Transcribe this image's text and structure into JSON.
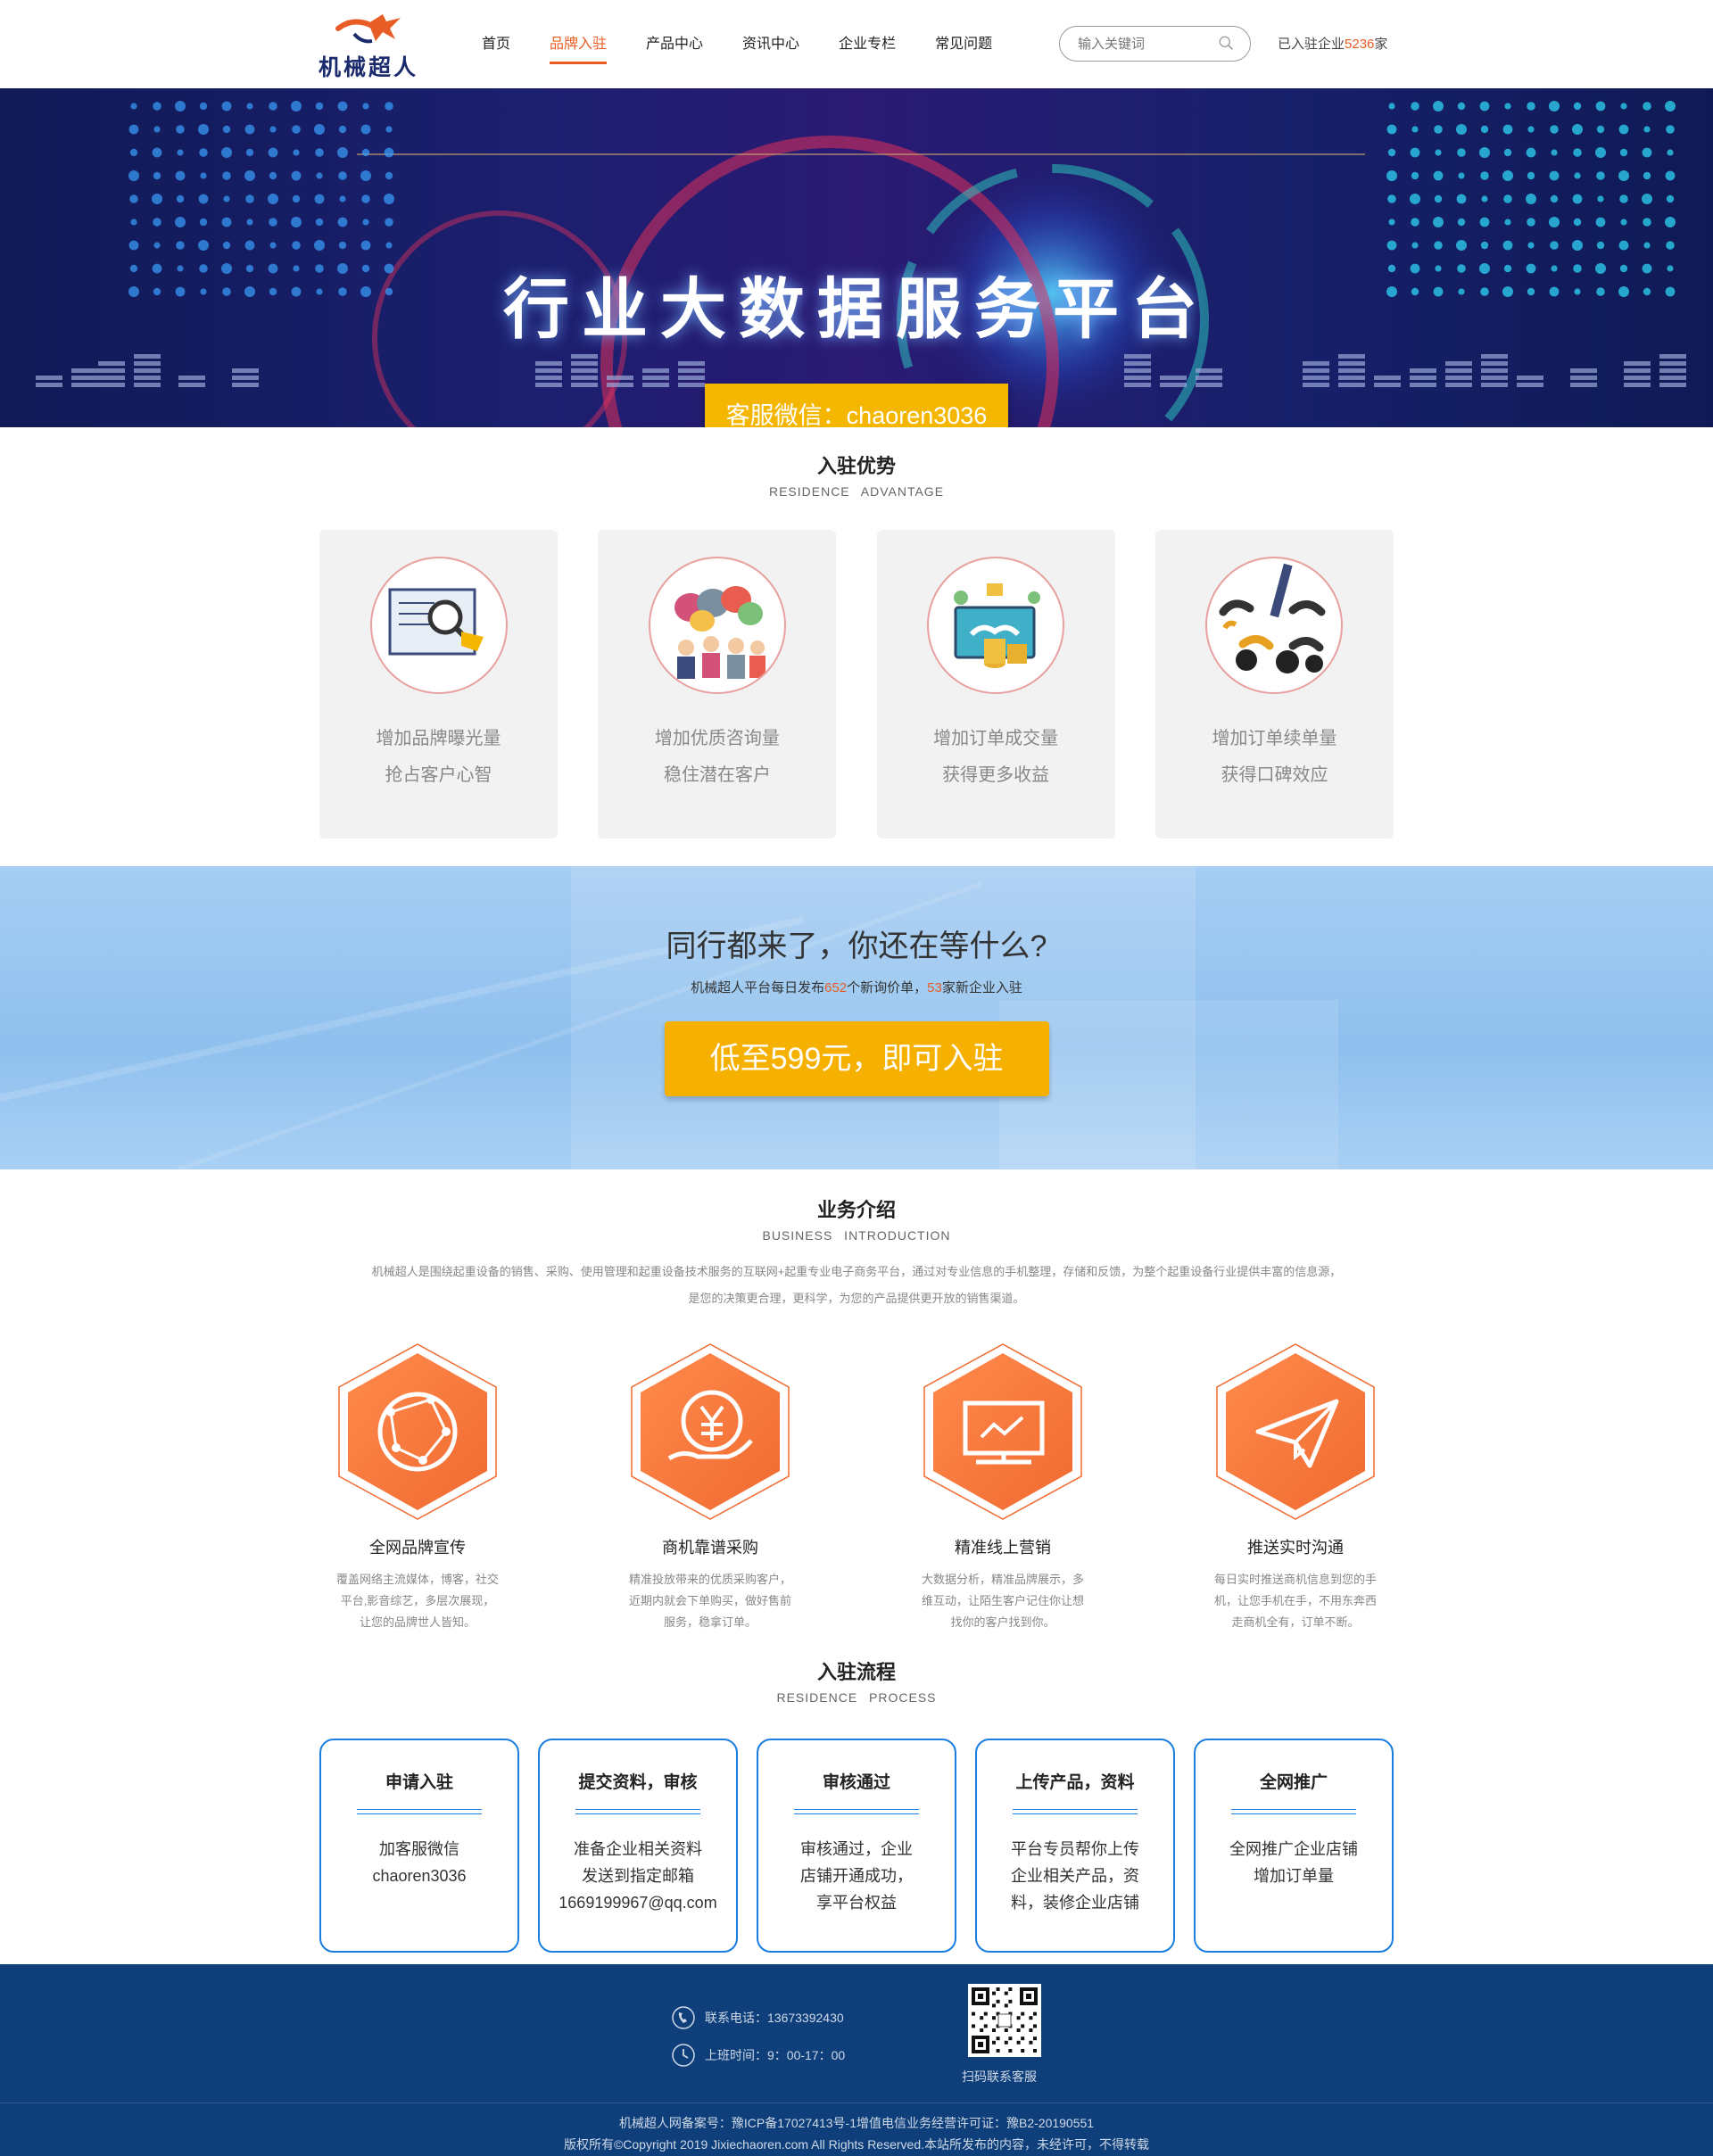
{
  "header": {
    "logo_text": "机械超人",
    "nav": [
      {
        "label": "首页",
        "active": false
      },
      {
        "label": "品牌入驻",
        "active": true
      },
      {
        "label": "产品中心",
        "active": false
      },
      {
        "label": "资讯中心",
        "active": false
      },
      {
        "label": "企业专栏",
        "active": false
      },
      {
        "label": "常见问题",
        "active": false
      }
    ],
    "search_placeholder": "输入关键词",
    "joined_prefix": "已入驻企业",
    "joined_count": "5236",
    "joined_suffix": "家"
  },
  "banner": {
    "title": "行业大数据服务平台",
    "wechat_button": "客服微信：chaoren3036"
  },
  "advantages": {
    "title": "入驻优势",
    "subtitle": "RESIDENCE ADVANTAGE",
    "cards": [
      {
        "icon": "magnifier-document-icon",
        "line1": "增加品牌曝光量",
        "line2": "抢占客户心智"
      },
      {
        "icon": "speech-bubbles-people-icon",
        "line1": "增加优质咨询量",
        "line2": "稳住潜在客户"
      },
      {
        "icon": "handshake-coins-icon",
        "line1": "增加订单成交量",
        "line2": "获得更多收益"
      },
      {
        "icon": "telephones-icon",
        "line1": "增加订单续单量",
        "line2": "获得口碑效应"
      }
    ]
  },
  "cta": {
    "heading": "同行都来了，你还在等什么?",
    "sub_prefix": "机械超人平台每日发布",
    "sub_num1": "652",
    "sub_mid": "个新询价单，",
    "sub_num2": "53",
    "sub_suffix": "家新企业入驻",
    "button": "低至599元，即可入驻"
  },
  "business": {
    "title": "业务介绍",
    "subtitle": "BUSINESS INTRODUCTION",
    "desc_line1": "机械超人是围绕起重设备的销售、采购、使用管理和起重设备技术服务的互联网+起重专业电子商务平台，通过对专业信息的手机整理，存储和反馈，为整个起重设备行业提供丰富的信息源，",
    "desc_line2": "是您的决策更合理，更科学，为您的产品提供更开放的销售渠道。",
    "items": [
      {
        "icon": "globe-network-icon",
        "title": "全网品牌宣传",
        "text": "覆盖网络主流媒体，博客，社交平台,影音综艺，多层次展现，让您的品牌世人皆知。"
      },
      {
        "icon": "yuan-hand-icon",
        "title": "商机靠谱采购",
        "text": "精准投放带来的优质采购客户，近期内就会下单购买，做好售前服务，稳拿订单。"
      },
      {
        "icon": "monitor-chart-icon",
        "title": "精准线上营销",
        "text": "大数据分析，精准品牌展示，多维互动，让陌生客户记住你让想找你的客户找到你。"
      },
      {
        "icon": "paper-plane-icon",
        "title": "推送实时沟通",
        "text": "每日实时推送商机信息到您的手机，让您手机在手，不用东奔西走商机全有，订单不断。"
      }
    ]
  },
  "process": {
    "title": "入驻流程",
    "subtitle": "RESIDENCE PROCESS",
    "steps": [
      {
        "title": "申请入驻",
        "lines": [
          "加客服微信",
          "chaoren3036"
        ]
      },
      {
        "title": "提交资料，审核",
        "lines": [
          "准备企业相关资料",
          "发送到指定邮箱",
          "1669199967@qq.com"
        ]
      },
      {
        "title": "审核通过",
        "lines": [
          "审核通过，企业",
          "店铺开通成功，",
          "享平台权益"
        ]
      },
      {
        "title": "上传产品，资料",
        "lines": [
          "平台专员帮你上传",
          "企业相关产品，资",
          "料，装修企业店铺"
        ]
      },
      {
        "title": "全网推广",
        "lines": [
          "全网推广企业店铺",
          "增加订单量"
        ]
      }
    ]
  },
  "footer": {
    "phone": "联系电话：13673392430",
    "hours": "上班时间：9：00-17：00",
    "qr_label": "扫码联系客服",
    "icp": "机械超人网备案号：豫ICP备17027413号-1增值电信业务经营许可证：豫B2-20190551",
    "copyright": "版权所有©Copyright 2019 Jixiechaoren.com All Rights Reserved.本站所发布的内容，未经许可，不得转载"
  },
  "colors": {
    "accent": "#e85d26",
    "yellow": "#f5b600",
    "blue": "#1a7de0",
    "footer": "#0e3f7a"
  }
}
